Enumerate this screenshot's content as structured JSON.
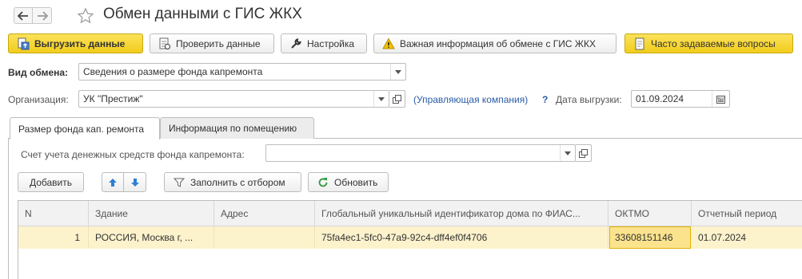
{
  "window": {
    "title": "Обмен данными с ГИС ЖКХ",
    "back_icon": "arrow-left-icon",
    "forward_icon": "arrow-right-icon",
    "favorite_icon": "star-icon"
  },
  "toolbar": {
    "upload_label": "Выгрузить данные",
    "check_label": "Проверить данные",
    "settings_label": "Настройка",
    "important_label": "Важная информация об обмене с ГИС ЖКХ",
    "faq_label": "Часто задаваемые вопросы"
  },
  "form": {
    "exchange_type_label": "Вид обмена:",
    "exchange_type_value": "Сведения о размере фонда капремонта",
    "organization_label": "Организация:",
    "organization_value": "УК \"Престиж\"",
    "org_role_link": "(Управляющая компания)",
    "help_mark": "?",
    "upload_date_label": "Дата выгрузки:",
    "upload_date_value": "01.09.2024"
  },
  "tabs": [
    {
      "label": "Размер фонда кап. ремонта",
      "active": true
    },
    {
      "label": "Информация по помещению",
      "active": false
    }
  ],
  "fund_tab": {
    "account_label": "Счет учета денежных средств фонда капремонта:",
    "account_value": "",
    "add_label": "Добавить",
    "fill_filter_label": "Заполнить с отбором",
    "refresh_label": "Обновить"
  },
  "table": {
    "columns": [
      "N",
      "Здание",
      "Адрес",
      "Глобальный уникальный идентификатор дома по ФИАС...",
      "ОКТМО",
      "Отчетный период"
    ],
    "rows": [
      {
        "n": "1",
        "building": "РОССИЯ, Москва г, ...",
        "address": "",
        "fias_guid": "75fa4ec1-5fc0-47a9-92c4-dff4ef0f4706",
        "oktmo": "33608151146",
        "period": "01.07.2024"
      }
    ]
  },
  "colors": {
    "accent_yellow": "#f5d324",
    "selected_row": "#fcf2cc",
    "selected_cell": "#fbe38e",
    "link": "#2a5ca8"
  }
}
